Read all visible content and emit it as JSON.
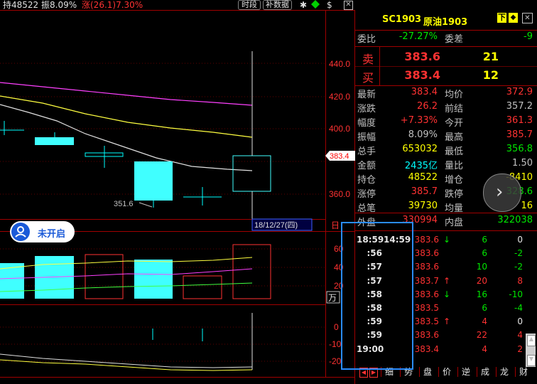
{
  "header": {
    "hold": "持48522",
    "amp": "振8.09%",
    "chg": "涨(26.1)7.30%",
    "btn_time": "时段",
    "btn_fill": "补数据"
  },
  "chart": {
    "price_ticks": [
      "440.0",
      "420.0",
      "400.0",
      "380.0",
      "360.0"
    ],
    "price_marker": "383.4",
    "low_label": "351.6",
    "date_label": "18/12/27(四)",
    "day_label": "日",
    "vol_ticks": [
      "60",
      "40",
      "20"
    ],
    "vol_unit": "万",
    "ind_ticks": [
      "0",
      "-10",
      "-20"
    ],
    "not_open": "未开启"
  },
  "quote": {
    "code": "SC1903",
    "name": "原油1903",
    "btn_down": "下",
    "btn_diamond": "◆",
    "webi_label": "委比",
    "webi_val": "-27.27%",
    "wecha_label": "委差",
    "wecha_val": "-9",
    "sell_label": "卖",
    "sell_price": "383.6",
    "sell_vol": "21",
    "buy_label": "买",
    "buy_price": "383.4",
    "buy_vol": "12",
    "stats": [
      {
        "l1": "最新",
        "v1": "383.4",
        "c1": "red",
        "l2": "均价",
        "v2": "372.9",
        "c2": "red"
      },
      {
        "l1": "涨跌",
        "v1": "26.2",
        "c1": "red",
        "l2": "前结",
        "v2": "357.2",
        "c2": "gray"
      },
      {
        "l1": "幅度",
        "v1": "+7.33%",
        "c1": "red",
        "l2": "今开",
        "v2": "361.3",
        "c2": "red"
      },
      {
        "l1": "振幅",
        "v1": "8.09%",
        "c1": "gray",
        "l2": "最高",
        "v2": "385.7",
        "c2": "red"
      },
      {
        "l1": "总手",
        "v1": "653032",
        "c1": "yellow",
        "l2": "最低",
        "v2": "356.8",
        "c2": "green"
      },
      {
        "l1": "金额",
        "v1": "2435亿",
        "c1": "cyan",
        "l2": "量比",
        "v2": "1.50",
        "c2": "gray"
      },
      {
        "l1": "持仓",
        "v1": "48522",
        "c1": "yellow",
        "l2": "增仓",
        "v2": "-8410",
        "c2": "yellow"
      },
      {
        "l1": "涨停",
        "v1": "385.7",
        "c1": "red",
        "l2": "跌停",
        "v2": "328.6",
        "c2": "green"
      },
      {
        "l1": "总笔",
        "v1": "39730",
        "c1": "yellow",
        "l2": "均量",
        "v2": "16",
        "c2": "yellow"
      }
    ],
    "outer_label": "外盘",
    "outer_val": "330994",
    "inner_label": "内盘",
    "inner_val": "322038"
  },
  "ticks": [
    {
      "t1": "18:59",
      "t2": "14:59",
      "p": "383.6",
      "arrow": "↓",
      "ac": "green",
      "v": "6",
      "vc": "green",
      "d": "0",
      "dc": "white"
    },
    {
      "t1": ":56",
      "t2": "",
      "p": "383.6",
      "arrow": "",
      "ac": "",
      "v": "6",
      "vc": "green",
      "d": "-2",
      "dc": "green"
    },
    {
      "t1": ":57",
      "t2": "",
      "p": "383.6",
      "arrow": "",
      "ac": "",
      "v": "10",
      "vc": "green",
      "d": "-2",
      "dc": "green"
    },
    {
      "t1": ":57",
      "t2": "",
      "p": "383.7",
      "arrow": "↑",
      "ac": "red",
      "v": "20",
      "vc": "red",
      "d": "8",
      "dc": "red"
    },
    {
      "t1": ":58",
      "t2": "",
      "p": "383.6",
      "arrow": "↓",
      "ac": "green",
      "v": "16",
      "vc": "green",
      "d": "-10",
      "dc": "green"
    },
    {
      "t1": ":58",
      "t2": "",
      "p": "383.5",
      "arrow": "",
      "ac": "",
      "v": "6",
      "vc": "green",
      "d": "-4",
      "dc": "green"
    },
    {
      "t1": ":59",
      "t2": "",
      "p": "383.5",
      "arrow": "↑",
      "ac": "red",
      "v": "4",
      "vc": "red",
      "d": "0",
      "dc": "white"
    },
    {
      "t1": ":59",
      "t2": "",
      "p": "383.6",
      "arrow": "",
      "ac": "",
      "v": "22",
      "vc": "red",
      "d": "4",
      "dc": "red"
    },
    {
      "t1": "19:00",
      "t2": "",
      "p": "383.4",
      "arrow": "",
      "ac": "",
      "v": "4",
      "vc": "red",
      "d": "2",
      "dc": "red"
    }
  ],
  "tabs": [
    "细",
    "势",
    "盘",
    "价",
    "逆",
    "成",
    "龙",
    "财"
  ]
}
